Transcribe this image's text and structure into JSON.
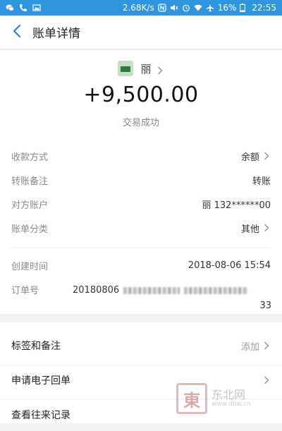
{
  "status_bar": {
    "speed": "2.68K/s",
    "battery": "16%",
    "time": "22:55",
    "icons": [
      "wechat-icon",
      "phone-icon",
      "image-icon",
      "nfc-icon",
      "mute-icon",
      "alarm-icon",
      "wifi-icon",
      "airplane-icon",
      "battery-icon"
    ]
  },
  "header": {
    "title": "账单详情",
    "back_icon": "back-arrow-icon"
  },
  "summary": {
    "payee_name": "丽",
    "amount": "+9,500.00",
    "status": "交易成功"
  },
  "details": {
    "rows": [
      {
        "label": "收款方式",
        "value": "余额",
        "has_arrow": true
      },
      {
        "label": "转账备注",
        "value": "转账",
        "has_arrow": false
      },
      {
        "label": "对方账户",
        "value": "丽 132******00",
        "has_arrow": false
      },
      {
        "label": "账单分类",
        "value": "其他",
        "has_arrow": true
      }
    ],
    "created_label": "创建时间",
    "created_value": "2018-08-06 15:54",
    "order_label": "订单号",
    "order_prefix": "20180806",
    "order_suffix": "33"
  },
  "actions": [
    {
      "label": "标签和备注",
      "right_text": "添加"
    },
    {
      "label": "申请电子回单",
      "right_text": ""
    },
    {
      "label": "查看往来记录",
      "right_text": ""
    }
  ],
  "watermark": {
    "glyph": "東",
    "text": "东北网",
    "sub": "www.dbw.cn"
  },
  "colors": {
    "statusbar": "#2f95dc",
    "back_arrow": "#2f7fd6"
  }
}
